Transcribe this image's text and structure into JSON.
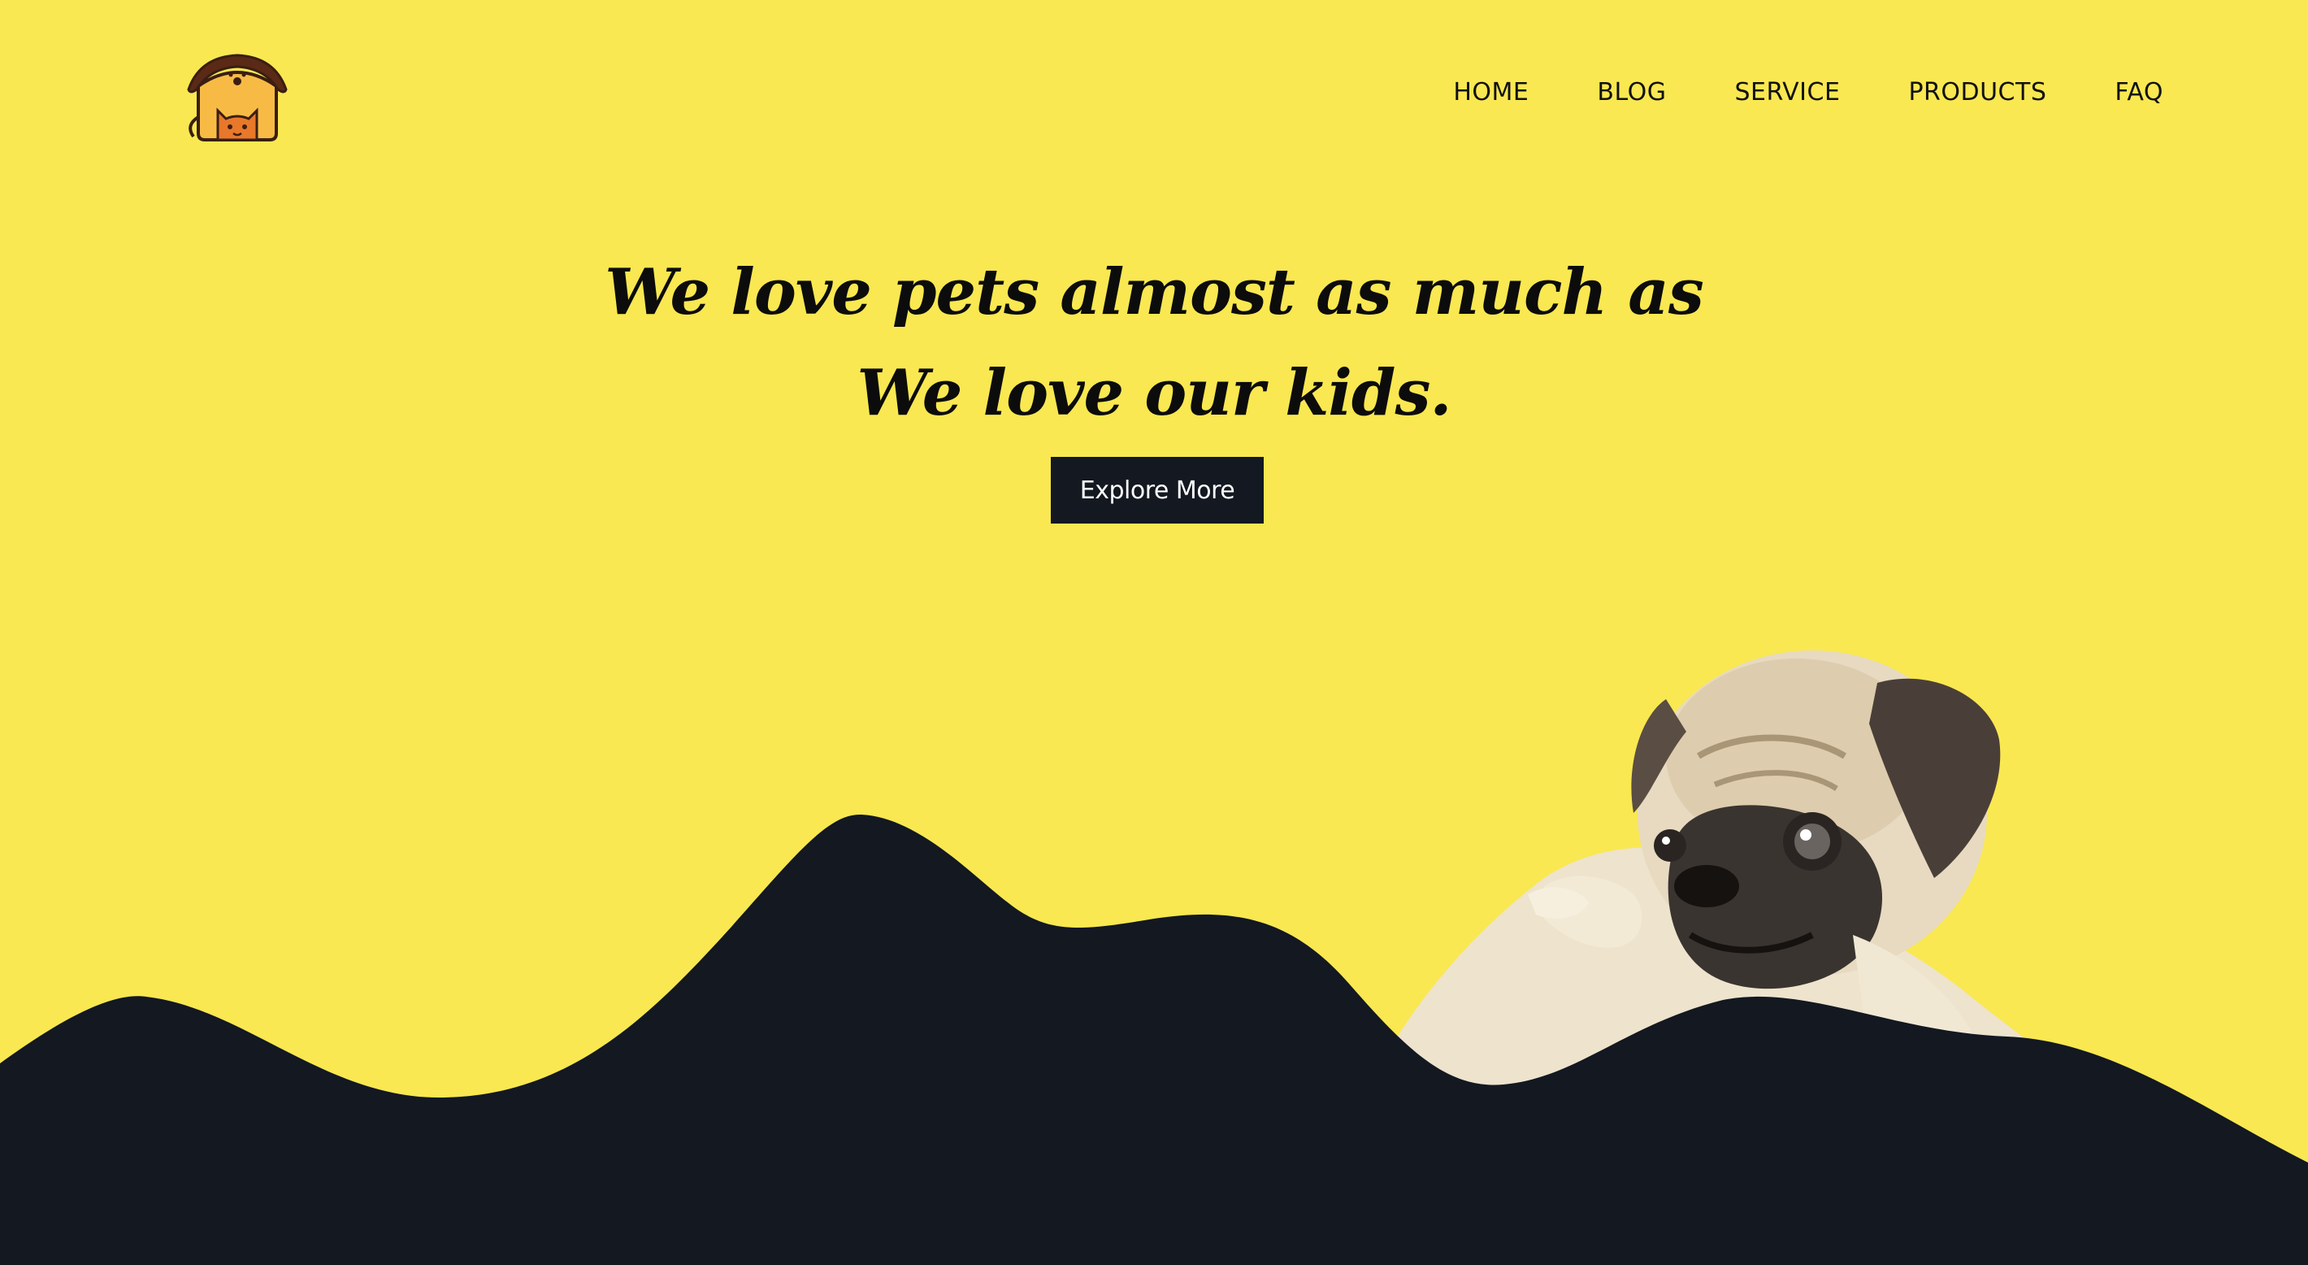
{
  "brand": {
    "logo_icon": "pet-house-logo-icon"
  },
  "nav": {
    "items": [
      {
        "label": "HOME"
      },
      {
        "label": "BLOG"
      },
      {
        "label": "SERVICE"
      },
      {
        "label": "PRODUCTS"
      },
      {
        "label": "FAQ"
      }
    ]
  },
  "hero": {
    "line1": "We love pets almost as much as",
    "line2": "We love our kids.",
    "cta_label": "Explore More"
  },
  "decor": {
    "hills_icon": "dark-wave-hills",
    "pet_image": "pug-puppy-image"
  },
  "colors": {
    "background": "#f9e851",
    "dark": "#131821",
    "button_text": "#ffffff"
  }
}
